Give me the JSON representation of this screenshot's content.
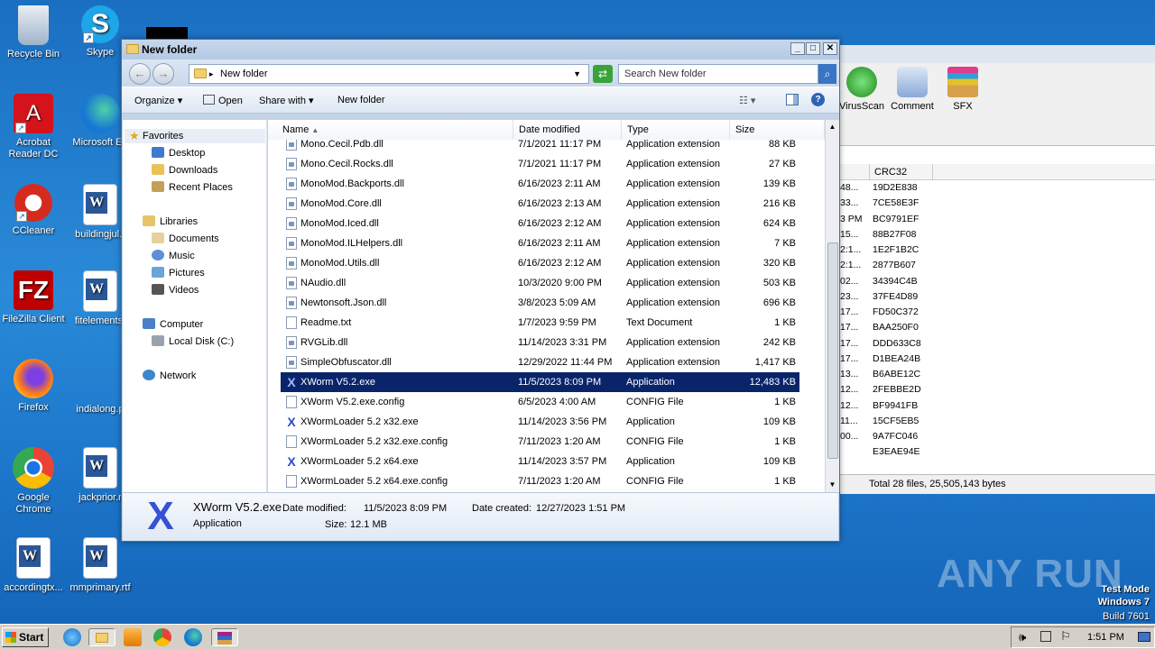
{
  "desktop_icons": [
    {
      "label": "Recycle Bin",
      "icon": "recycle-bin-icon"
    },
    {
      "label": "Skype",
      "icon": "skype-icon"
    },
    {
      "label": "Acrobat Reader DC",
      "icon": "acrobat-icon"
    },
    {
      "label": "Microsoft Ed",
      "icon": "edge-icon"
    },
    {
      "label": "CCleaner",
      "icon": "ccleaner-icon"
    },
    {
      "label": "buildingjul.r",
      "icon": "word-doc-icon"
    },
    {
      "label": "FileZilla Client",
      "icon": "filezilla-icon"
    },
    {
      "label": "fitelements.",
      "icon": "word-doc-icon"
    },
    {
      "label": "Firefox",
      "icon": "firefox-icon"
    },
    {
      "label": "indialong.p",
      "icon": "blank-doc-icon"
    },
    {
      "label": "Google Chrome",
      "icon": "chrome-icon"
    },
    {
      "label": "jackprior.r",
      "icon": "word-doc-icon"
    },
    {
      "label": "accordingtx...",
      "icon": "word-doc-icon"
    },
    {
      "label": "mmprimary.rtf",
      "icon": "word-doc-icon"
    }
  ],
  "bg_window": {
    "toolbar": [
      {
        "label": "VirusScan",
        "icon": "virusscan-icon",
        "color": "#2e9e2e"
      },
      {
        "label": "Comment",
        "icon": "comment-icon",
        "color": "#8aa9d8"
      },
      {
        "label": "SFX",
        "icon": "sfx-icon",
        "color": "#d9a04a"
      }
    ],
    "crc_header": "CRC32",
    "left_fragments": [
      "48...",
      "33...",
      "3 PM",
      "15...",
      "2:1...",
      "2:1...",
      "02...",
      "23...",
      "17...",
      "17...",
      "17...",
      "17...",
      "13...",
      "12...",
      "12...",
      "11...",
      "00..."
    ],
    "crc_values": [
      "19D2E838",
      "7CE58E3F",
      "BC9791EF",
      "88B27F08",
      "1E2F1B2C",
      "2877B607",
      "34394C4B",
      "37FE4D89",
      "FD50C372",
      "BAA250F0",
      "DDD633C8",
      "D1BEA24B",
      "B6ABE12C",
      "2FEBBE2D",
      "BF9941FB",
      "15CF5EB5",
      "9A7FC046",
      "E3EAE94E"
    ],
    "status": "Total 28 files, 25,505,143 bytes"
  },
  "explorer": {
    "title": "New folder",
    "address": "New folder",
    "search_placeholder": "Search New folder",
    "commands": {
      "organize": "Organize",
      "open": "Open",
      "share": "Share with",
      "new_folder": "New folder"
    },
    "nav": {
      "favorites": "Favorites",
      "desktop": "Desktop",
      "downloads": "Downloads",
      "recent": "Recent Places",
      "libraries": "Libraries",
      "documents": "Documents",
      "music": "Music",
      "pictures": "Pictures",
      "videos": "Videos",
      "computer": "Computer",
      "local_disk": "Local Disk (C:)",
      "network": "Network"
    },
    "columns": {
      "name": "Name",
      "date": "Date modified",
      "type": "Type",
      "size": "Size"
    },
    "files": [
      {
        "name": "Mono.Cecil.Pdb.dll",
        "date": "7/1/2021 11:17 PM",
        "type": "Application extension",
        "size": "88 KB",
        "icon": "dll"
      },
      {
        "name": "Mono.Cecil.Rocks.dll",
        "date": "7/1/2021 11:17 PM",
        "type": "Application extension",
        "size": "27 KB",
        "icon": "dll"
      },
      {
        "name": "MonoMod.Backports.dll",
        "date": "6/16/2023 2:11 AM",
        "type": "Application extension",
        "size": "139 KB",
        "icon": "dll"
      },
      {
        "name": "MonoMod.Core.dll",
        "date": "6/16/2023 2:13 AM",
        "type": "Application extension",
        "size": "216 KB",
        "icon": "dll"
      },
      {
        "name": "MonoMod.Iced.dll",
        "date": "6/16/2023 2:12 AM",
        "type": "Application extension",
        "size": "624 KB",
        "icon": "dll"
      },
      {
        "name": "MonoMod.ILHelpers.dll",
        "date": "6/16/2023 2:11 AM",
        "type": "Application extension",
        "size": "7 KB",
        "icon": "dll"
      },
      {
        "name": "MonoMod.Utils.dll",
        "date": "6/16/2023 2:12 AM",
        "type": "Application extension",
        "size": "320 KB",
        "icon": "dll"
      },
      {
        "name": "NAudio.dll",
        "date": "10/3/2020 9:00 PM",
        "type": "Application extension",
        "size": "503 KB",
        "icon": "dll"
      },
      {
        "name": "Newtonsoft.Json.dll",
        "date": "3/8/2023 5:09 AM",
        "type": "Application extension",
        "size": "696 KB",
        "icon": "dll"
      },
      {
        "name": "Readme.txt",
        "date": "1/7/2023 9:59 PM",
        "type": "Text Document",
        "size": "1 KB",
        "icon": "txt"
      },
      {
        "name": "RVGLib.dll",
        "date": "11/14/2023 3:31 PM",
        "type": "Application extension",
        "size": "242 KB",
        "icon": "dll"
      },
      {
        "name": "SimpleObfuscator.dll",
        "date": "12/29/2022 11:44 PM",
        "type": "Application extension",
        "size": "1,417 KB",
        "icon": "dll"
      },
      {
        "name": "XWorm V5.2.exe",
        "date": "11/5/2023 8:09 PM",
        "type": "Application",
        "size": "12,483 KB",
        "icon": "xw",
        "selected": true
      },
      {
        "name": "XWorm V5.2.exe.config",
        "date": "6/5/2023 4:00 AM",
        "type": "CONFIG File",
        "size": "1 KB",
        "icon": "txt"
      },
      {
        "name": "XWormLoader 5.2 x32.exe",
        "date": "11/14/2023 3:56 PM",
        "type": "Application",
        "size": "109 KB",
        "icon": "xw"
      },
      {
        "name": "XWormLoader 5.2 x32.exe.config",
        "date": "7/11/2023 1:20 AM",
        "type": "CONFIG File",
        "size": "1 KB",
        "icon": "txt"
      },
      {
        "name": "XWormLoader 5.2 x64.exe",
        "date": "11/14/2023 3:57 PM",
        "type": "Application",
        "size": "109 KB",
        "icon": "xw"
      },
      {
        "name": "XWormLoader 5.2 x64.exe.config",
        "date": "7/11/2023 1:20 AM",
        "type": "CONFIG File",
        "size": "1 KB",
        "icon": "txt"
      }
    ],
    "details": {
      "name": "XWorm V5.2.exe",
      "type": "Application",
      "modified_label": "Date modified:",
      "modified": "11/5/2023 8:09 PM",
      "size_label": "Size:",
      "size": "12.1 MB",
      "created_label": "Date created:",
      "created": "12/27/2023 1:51 PM"
    }
  },
  "taskbar": {
    "start": "Start",
    "clock": "1:51 PM"
  },
  "watermark": "ANY RUN",
  "test_mode": {
    "line1": "Test Mode",
    "line2": "Windows 7",
    "line3": "Build 7601"
  }
}
